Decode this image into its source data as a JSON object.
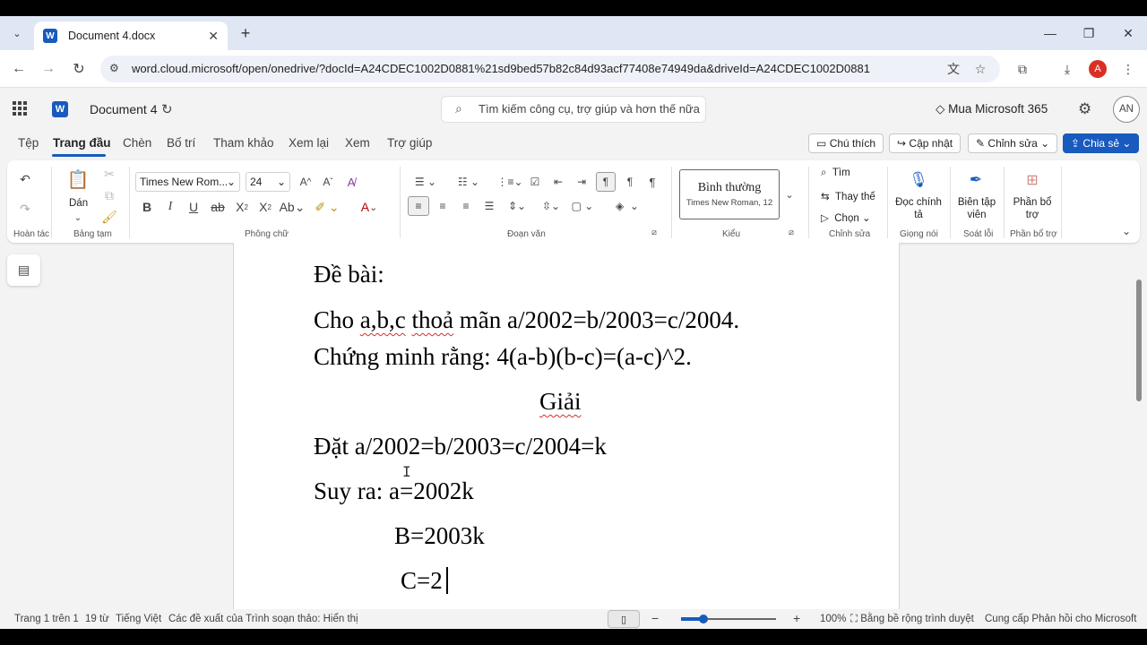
{
  "browser": {
    "tab_title": "Document 4.docx",
    "url": "word.cloud.microsoft/open/onedrive/?docId=A24CDEC1002D0881%21sd9bed57b82c84d93acf77408e74949da&driveId=A24CDEC1002D0881",
    "profile_initial": "A"
  },
  "app": {
    "doc_name": "Document 4",
    "search_placeholder": "Tìm kiếm công cụ, trợ giúp và hơn thế nữa",
    "buy_label": "Mua Microsoft 365",
    "user_initials": "AN"
  },
  "menu": [
    "Tệp",
    "Trang đầu",
    "Chèn",
    "Bố trí",
    "Tham khảo",
    "Xem lại",
    "Xem",
    "Trợ giúp"
  ],
  "actions": {
    "comments": "Chú thích",
    "update": "Cập nhật",
    "editing": "Chỉnh sửa",
    "share": "Chia sẻ"
  },
  "ribbon": {
    "undo_group": "Hoàn tác",
    "paste": "Dán",
    "clipboard": "Bảng tạm",
    "font_name": "Times New Rom...",
    "font_size": "24",
    "font_group": "Phông chữ",
    "paragraph_group": "Đoạn văn",
    "style_name": "Bình thường",
    "style_sub": "Times New Roman, 12",
    "styles_group": "Kiểu",
    "find": "Tìm",
    "replace": "Thay thế",
    "select": "Chọn",
    "editing_group": "Chỉnh sửa",
    "dictate": "Đọc chính tả",
    "voice_group": "Giọng nói",
    "editor": "Biên tập viên",
    "proofing_group": "Soát lỗi",
    "addins": "Phần bổ trợ",
    "addins_group": "Phần bổ trợ"
  },
  "document": {
    "line1": "Đề bài:",
    "line2_a": "Cho ",
    "line2_b": "a,b,c",
    "line2_c": " ",
    "line2_d": "thoả",
    "line2_e": " mãn a/2002=b/2003=c/2004.",
    "line3": "Chứng minh rằng: 4(a-b)(b-c)=(a-c)^2.",
    "line4": "Giải",
    "line5": "Đặt a/2002=b/2003=c/2004=k",
    "line6": "Suy ra: a=2002k",
    "line7": "B=2003k",
    "line8": "C=2"
  },
  "status": {
    "page": "Trang 1 trên 1",
    "words": "19 từ",
    "language": "Tiếng Việt",
    "suggestions": "Các đề xuất của Trình soạn thảo: Hiển thị",
    "zoom": "100%",
    "width_note": "Bằng bề rộng trình duyệt",
    "feedback": "Cung cấp Phản hồi cho Microsoft"
  }
}
